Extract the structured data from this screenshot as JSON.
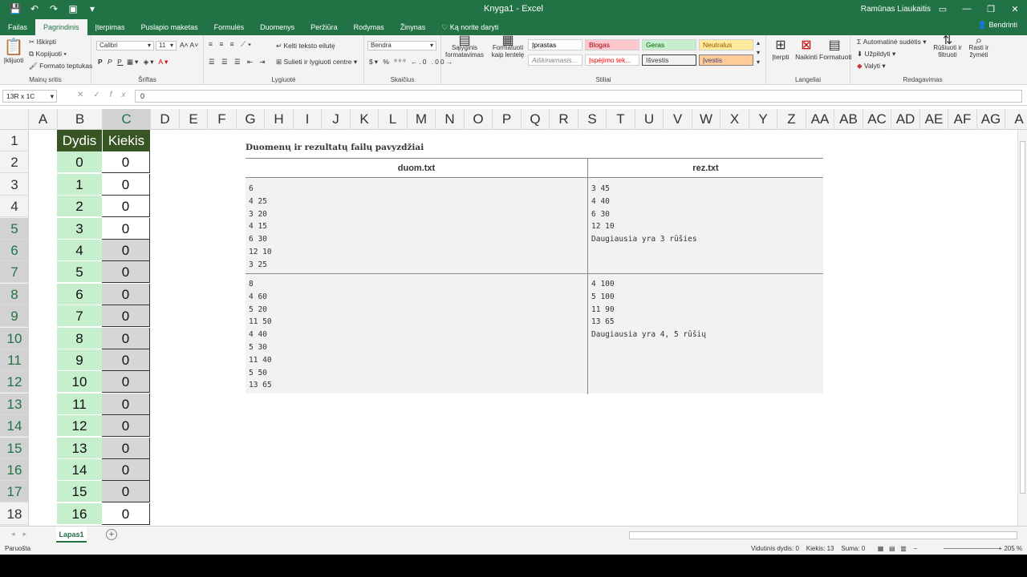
{
  "titlebar": {
    "title": "Knyga1 - Excel",
    "user": "Ramūnas Liaukaitis",
    "qat_icons": [
      "save-icon",
      "undo-icon",
      "redo-icon",
      "camera-icon",
      "customize-icon"
    ]
  },
  "tabs": {
    "items": [
      "Failas",
      "Pagrindinis",
      "Įterpimas",
      "Puslapio maketas",
      "Formulės",
      "Duomenys",
      "Peržiūra",
      "Rodymas",
      "Žinynas",
      "Ką norite daryti"
    ],
    "active": "Pagrindinis",
    "share": "Bendrinti"
  },
  "ribbon": {
    "clipboard": {
      "paste": "Įklijuoti",
      "cut": "Iškirpti",
      "copy": "Kopijuoti",
      "format_painter": "Formato teptukas",
      "label": "Mainų sritis"
    },
    "font": {
      "family": "Calibri",
      "size": "11",
      "bold": "P",
      "italic": "P",
      "underline": "P",
      "label": "Šriftas"
    },
    "alignment": {
      "wrap": "Kelti teksto eilutę",
      "merge": "Sulieti ir lygiuoti centre",
      "label": "Lygiuotė"
    },
    "number": {
      "format": "Bendra",
      "label": "Skaičius"
    },
    "styles": {
      "cond_format": "Sąlyginis formatavimas",
      "format_table": "Formatuoti kaip lentelę",
      "items": [
        {
          "label": "Įprastas",
          "bg": "#ffffff",
          "fg": "#000000"
        },
        {
          "label": "Blogas",
          "bg": "#ffc7ce",
          "fg": "#9c0006"
        },
        {
          "label": "Geras",
          "bg": "#c6efce",
          "fg": "#006100"
        },
        {
          "label": "Neutralus",
          "bg": "#ffeb9c",
          "fg": "#9c5700"
        },
        {
          "label": "Aiškinamasis...",
          "bg": "#ffffff",
          "fg": "#7f7f7f"
        },
        {
          "label": "Įspėjimo tek...",
          "bg": "#ffffff",
          "fg": "#ff0000"
        },
        {
          "label": "Išvestis",
          "bg": "#f2f2f2",
          "fg": "#3f3f3f"
        },
        {
          "label": "Įvestis",
          "bg": "#ffcc99",
          "fg": "#3f3f76"
        }
      ],
      "label": "Stiliai"
    },
    "cells": {
      "insert": "Įterpti",
      "delete": "Naikinti",
      "format": "Formatuoti",
      "label": "Langeliai"
    },
    "editing": {
      "autosum": "Automatinė sudėtis",
      "fill": "Užpildyti",
      "clear": "Valyti",
      "sort": "Rūšiuoti ir filtruoti",
      "find": "Rasti ir žymėti",
      "label": "Redagavimas"
    }
  },
  "formula_bar": {
    "name_box": "13R x 1C",
    "fx": "fx",
    "value": "0"
  },
  "columns": [
    "A",
    "B",
    "C",
    "D",
    "E",
    "F",
    "G",
    "H",
    "I",
    "J",
    "K",
    "L",
    "M",
    "N",
    "O",
    "P",
    "Q",
    "R",
    "S",
    "T",
    "U",
    "V",
    "W",
    "X",
    "Y",
    "Z",
    "AA",
    "AB",
    "AC",
    "AD",
    "AE",
    "AF",
    "AG",
    "A"
  ],
  "rows": [
    "1",
    "2",
    "3",
    "4",
    "5",
    "6",
    "7",
    "8",
    "9",
    "10",
    "11",
    "12",
    "13",
    "14",
    "15",
    "16",
    "17",
    "18"
  ],
  "sheet_table": {
    "header_b": "Dydis",
    "header_c": "Kiekis",
    "dydis": [
      "0",
      "1",
      "2",
      "3",
      "4",
      "5",
      "6",
      "7",
      "8",
      "9",
      "10",
      "11",
      "12",
      "13",
      "14",
      "15",
      "16"
    ],
    "kiekis": [
      "0",
      "0",
      "0",
      "0",
      "0",
      "0",
      "0",
      "0",
      "0",
      "0",
      "0",
      "0",
      "0",
      "0",
      "0",
      "0",
      "0"
    ]
  },
  "example": {
    "title": "Duomenų ir rezultatų failų pavyzdžiai",
    "col1": "duom.txt",
    "col2": "rez.txt",
    "duom1": "6\n4 25\n3 20\n4 15\n6 30\n12 10\n3 25",
    "rez1": "3 45\n4 40\n6 30\n12 10\nDaugiausia yra 3 rūšies",
    "duom2": "8\n4 60\n5 20\n11 50\n4 40\n5 30\n11 40\n5 50\n13 65",
    "rez2": "4 100\n5 100\n11 90\n13 65\nDaugiausia yra 4, 5 rūšių"
  },
  "sheet_tabs": {
    "active": "Lapas1"
  },
  "statusbar": {
    "ready": "Paruošta",
    "avg": "Vidutinis dydis: 0",
    "count": "Kiekis: 13",
    "sum": "Suma: 0",
    "zoom": "205 %"
  }
}
